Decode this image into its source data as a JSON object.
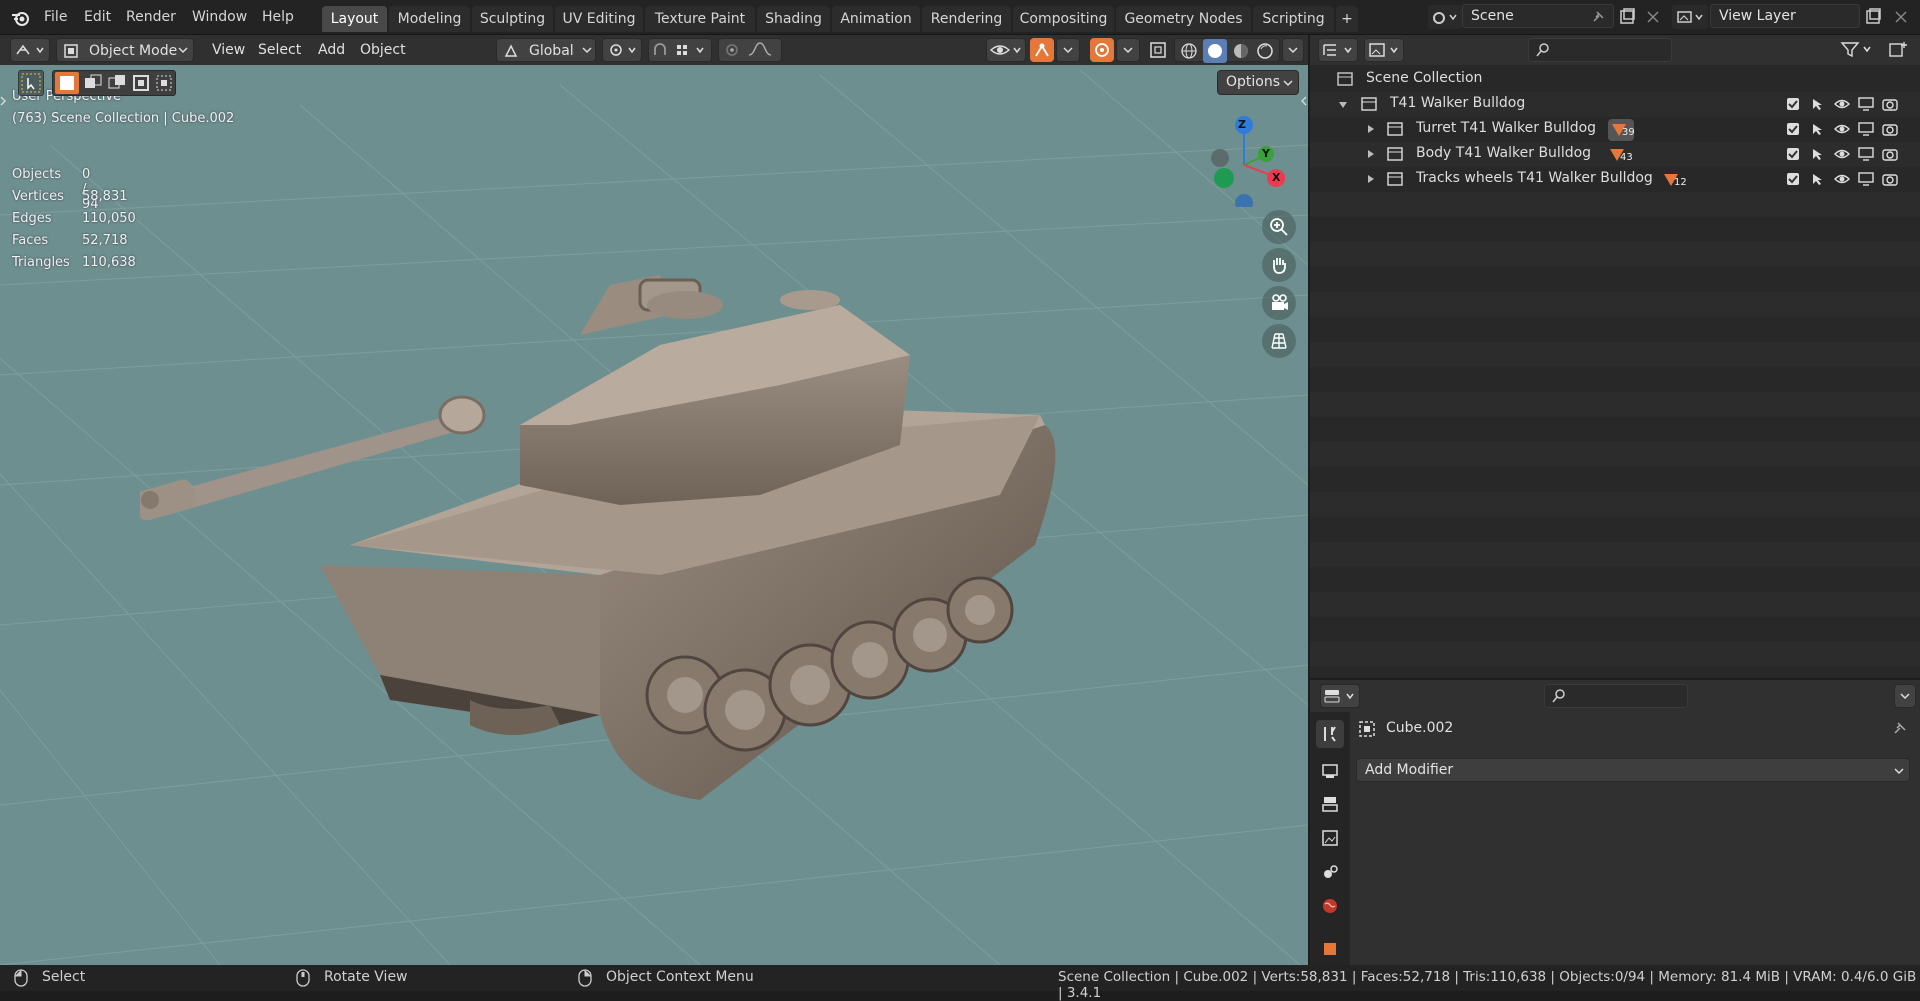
{
  "app": {
    "logo_icon": "blender-logo-icon"
  },
  "menu": [
    "File",
    "Edit",
    "Render",
    "Window",
    "Help"
  ],
  "workspaces": {
    "active": "Layout",
    "tabs": [
      "Layout",
      "Modeling",
      "Sculpting",
      "UV Editing",
      "Texture Paint",
      "Shading",
      "Animation",
      "Rendering",
      "Compositing",
      "Geometry Nodes",
      "Scripting"
    ],
    "add_label": "+"
  },
  "scene": {
    "name": "Scene",
    "view_layer": "View Layer"
  },
  "viewport_header": {
    "mode": "Object Mode",
    "menu": [
      "View",
      "Select",
      "Add",
      "Object"
    ],
    "transform_orientation": "Global",
    "options_label": "Options"
  },
  "viewport_overlay": {
    "perspective": "User Perspective",
    "collection_info": "(763) Scene Collection | Cube.002",
    "stats": [
      {
        "label": "Objects",
        "value": "0 / 94"
      },
      {
        "label": "Vertices",
        "value": "58,831"
      },
      {
        "label": "Edges",
        "value": "110,050"
      },
      {
        "label": "Faces",
        "value": "52,718"
      },
      {
        "label": "Triangles",
        "value": "110,638"
      }
    ],
    "gizmo_axes": {
      "z": "Z",
      "y": "Y",
      "x": "X"
    },
    "axis_colors": {
      "x": "#ee3a4f",
      "y": "#37a238",
      "z": "#2e7ddb"
    }
  },
  "outliner": {
    "root": "Scene Collection",
    "collection": "T41 Walker Bulldog",
    "children": [
      {
        "name": "Turret T41 Walker Bulldog",
        "count": "39"
      },
      {
        "name": "Body T41 Walker Bulldog",
        "count": "43"
      },
      {
        "name": "Tracks wheels T41 Walker Bulldog",
        "count": "12"
      }
    ]
  },
  "properties": {
    "object_name": "Cube.002",
    "add_modifier_label": "Add Modifier"
  },
  "statusbar": {
    "left": [
      {
        "icon": "mouse-left-icon",
        "label": "Select"
      },
      {
        "icon": "mouse-middle-icon",
        "label": "Rotate View"
      },
      {
        "icon": "mouse-right-icon",
        "label": "Object Context Menu"
      }
    ],
    "right": "Scene Collection | Cube.002 | Verts:58,831 | Faces:52,718 | Tris:110,638 | Objects:0/94 | Memory: 81.4 MiB | VRAM: 0.4/6.0 GiB | 3.4.1"
  },
  "colors": {
    "accent_orange": "#e5773a",
    "viewport_bg": "#6e8f8f",
    "active_tab": "#494949"
  }
}
